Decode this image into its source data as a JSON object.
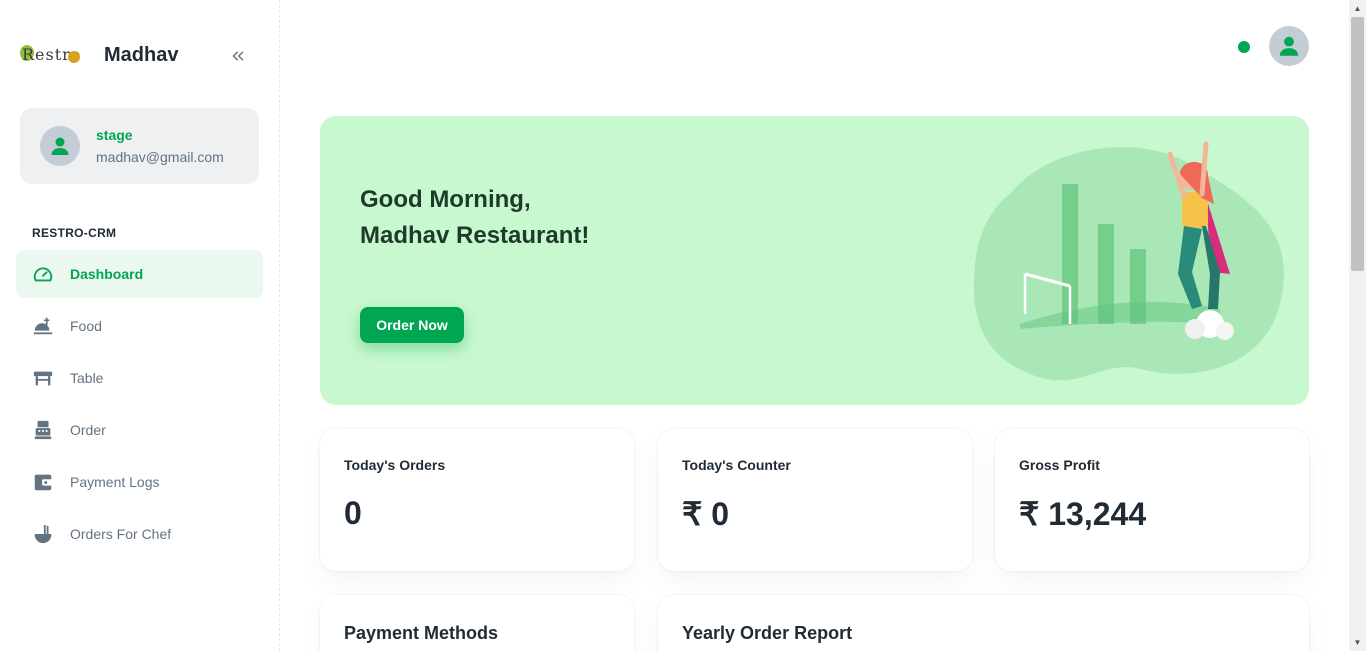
{
  "brand": {
    "logo_text": "Restro",
    "name": "Madhav"
  },
  "account": {
    "name": "stage",
    "email": "madhav@gmail.com"
  },
  "nav": {
    "subheader": "RESTRO-CRM",
    "items": [
      {
        "label": "Dashboard",
        "icon": "dashboard-icon",
        "active": true
      },
      {
        "label": "Food",
        "icon": "food-icon"
      },
      {
        "label": "Table",
        "icon": "table-icon"
      },
      {
        "label": "Order",
        "icon": "order-icon"
      },
      {
        "label": "Payment Logs",
        "icon": "wallet-icon"
      },
      {
        "label": "Orders For Chef",
        "icon": "chef-icon"
      }
    ]
  },
  "hero": {
    "greeting_line1": "Good Morning,",
    "greeting_line2": "Madhav Restaurant!",
    "button_label": "Order Now"
  },
  "stats": [
    {
      "label": "Today's Orders",
      "value": "0"
    },
    {
      "label": "Today's Counter",
      "value": "₹ 0"
    },
    {
      "label": "Gross Profit",
      "value": "₹ 13,244"
    }
  ],
  "sections": {
    "payment_methods": "Payment Methods",
    "yearly_order_report": "Yearly Order Report"
  },
  "colors": {
    "primary": "#00a651",
    "hero_bg": "#c8f8cf",
    "active_nav_bg": "#ebf8ef",
    "status_online": "#00a651"
  }
}
